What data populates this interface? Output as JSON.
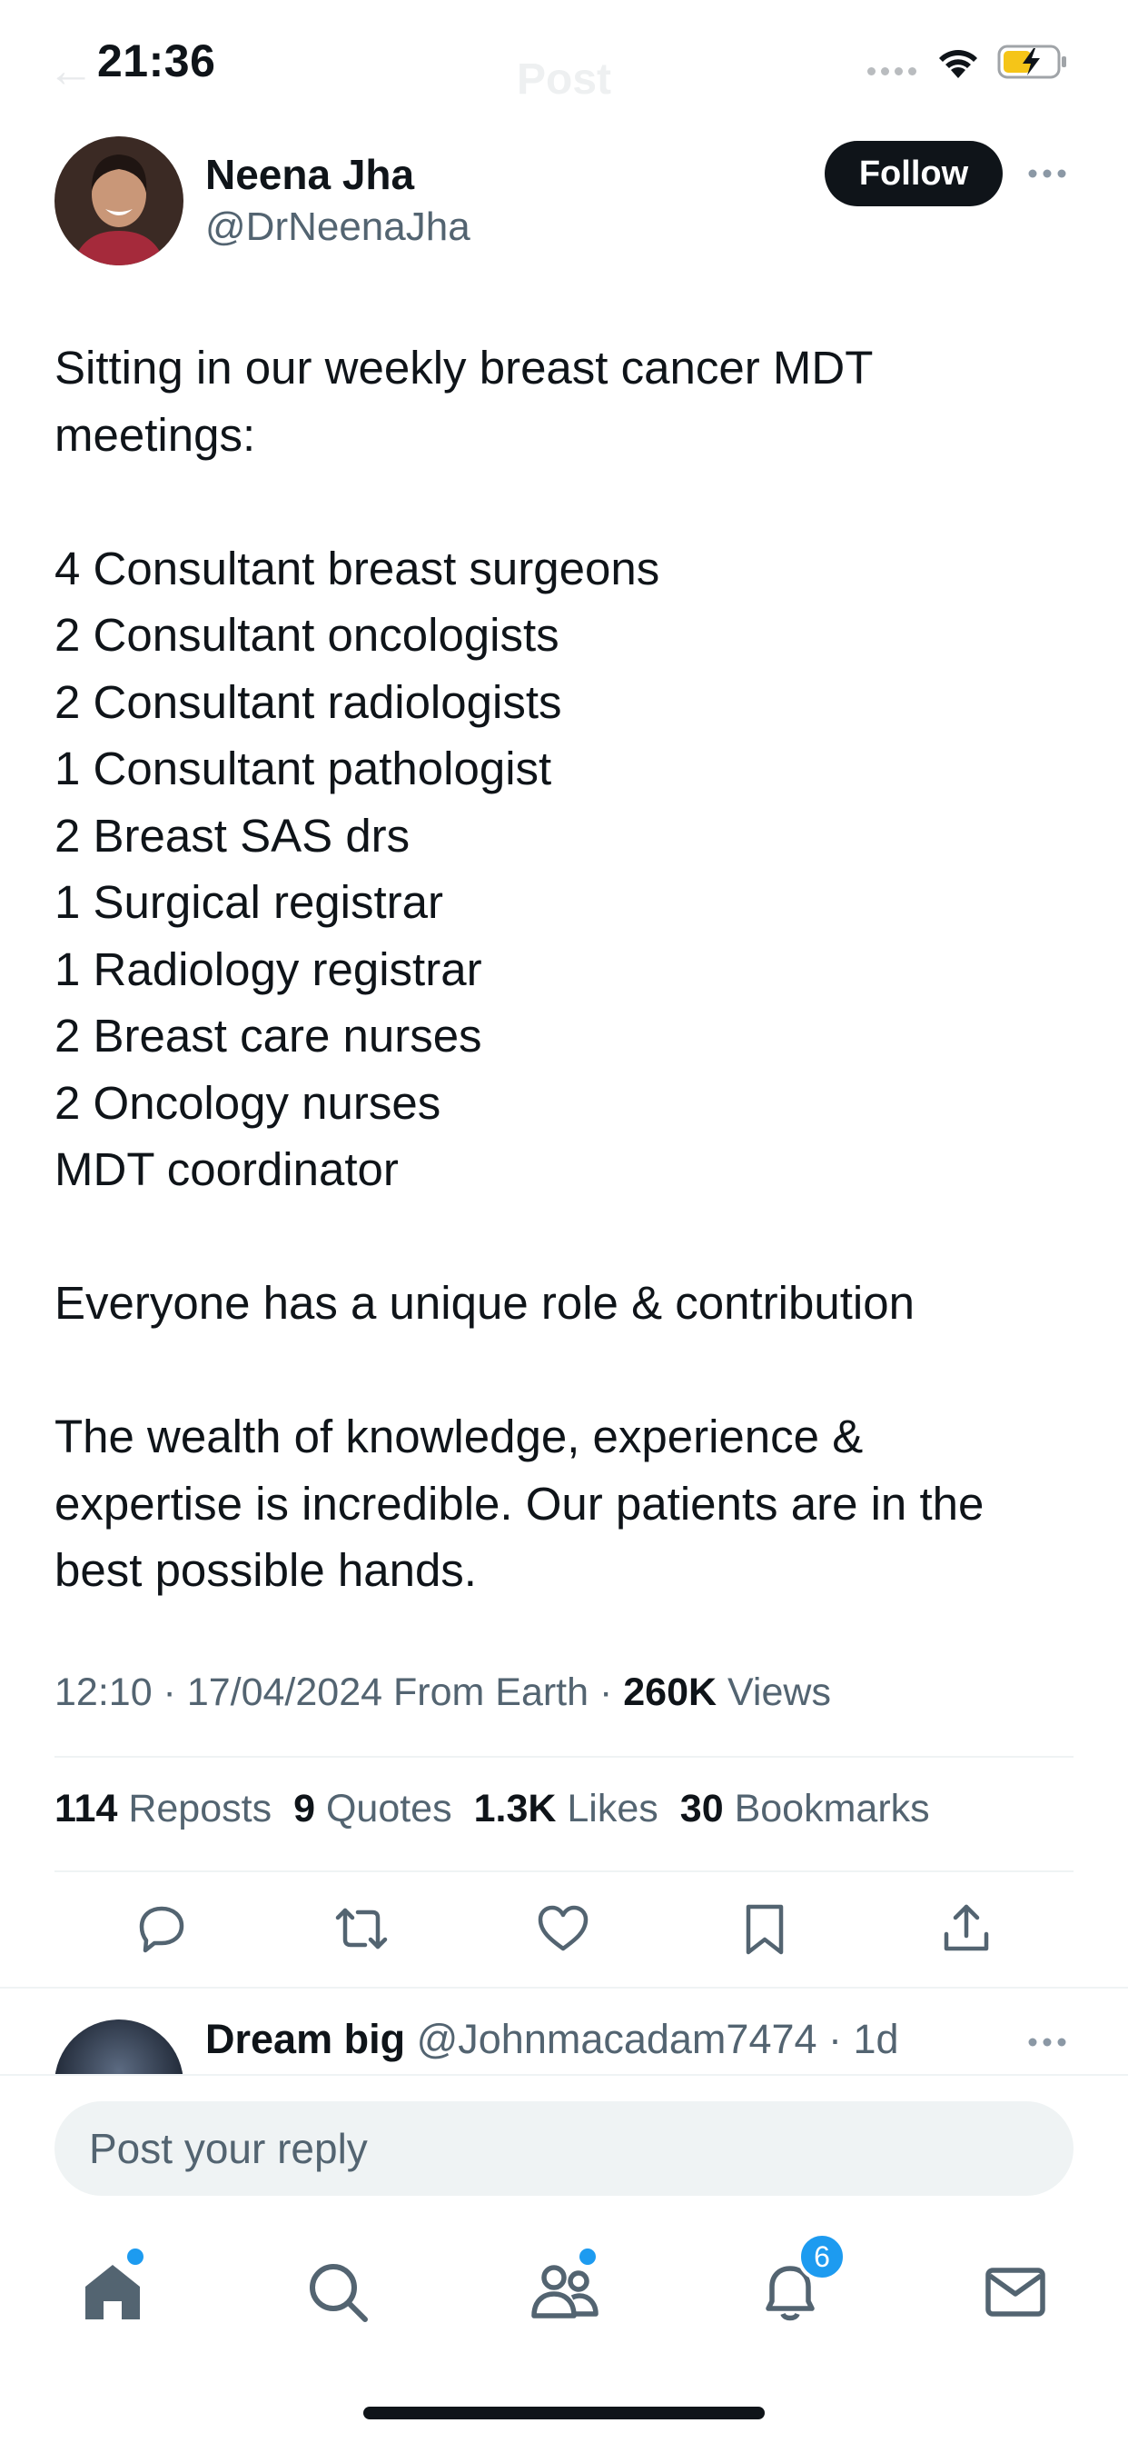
{
  "status_bar": {
    "time": "21:36"
  },
  "header": {
    "title": "Post"
  },
  "author": {
    "name": "Neena Jha",
    "handle": "@DrNeenaJha",
    "follow_label": "Follow"
  },
  "tweet": {
    "lines": [
      "Sitting in our weekly breast cancer MDT",
      "meetings:",
      "",
      "4 Consultant breast surgeons",
      "2 Consultant oncologists",
      "2 Consultant radiologists",
      "1 Consultant pathologist",
      "2 Breast SAS drs",
      "1 Surgical registrar",
      "1 Radiology registrar",
      "2 Breast care nurses",
      "2 Oncology nurses",
      "MDT coordinator",
      "",
      "Everyone has a unique role & contribution",
      "",
      "The wealth of knowledge, experience &",
      "expertise is incredible. Our patients are in the",
      "best possible hands."
    ]
  },
  "meta": {
    "time": "12:10",
    "date": "17/04/2024",
    "source": "From Earth",
    "views_count": "260K",
    "views_label": "Views"
  },
  "stats": {
    "reposts_count": "114",
    "reposts_label": "Reposts",
    "quotes_count": "9",
    "quotes_label": "Quotes",
    "likes_count": "1.3K",
    "likes_label": "Likes",
    "bookmarks_count": "30",
    "bookmarks_label": "Bookmarks"
  },
  "reply_preview": {
    "name": "Dream big",
    "handle": "@Johnmacadam7474",
    "age": "1d"
  },
  "composer": {
    "placeholder": "Post your reply"
  },
  "tabbar": {
    "notifications_badge": "6"
  },
  "colors": {
    "text": "#0f1419",
    "secondary": "#536471",
    "accent": "#1d9bf0",
    "divider": "#eff3f4"
  },
  "icons": [
    "reply-icon",
    "repost-icon",
    "like-icon",
    "bookmark-icon",
    "share-icon",
    "home-icon",
    "search-icon",
    "communities-icon",
    "notifications-icon",
    "messages-icon"
  ]
}
